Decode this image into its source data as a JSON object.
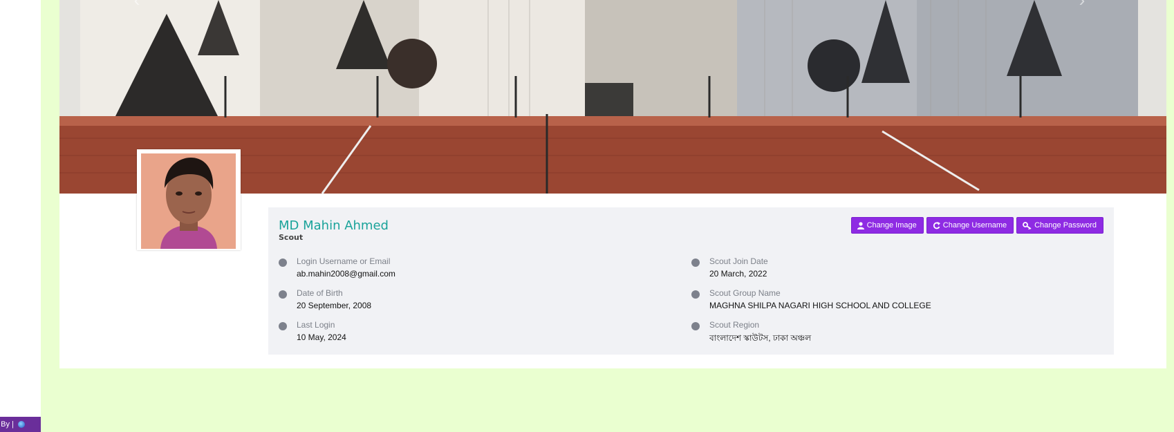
{
  "footer": {
    "powered_by": "d By |"
  },
  "profile": {
    "name": "MD Mahin Ahmed",
    "role": "Scout"
  },
  "actions": {
    "change_image": "Change Image",
    "change_username": "Change Username",
    "change_password": "Change Password"
  },
  "fields": {
    "login": {
      "label": "Login Username or Email",
      "value": "ab.mahin2008@gmail.com"
    },
    "dob": {
      "label": " Date of Birth",
      "value": "20 September, 2008"
    },
    "last_login": {
      "label": "Last Login",
      "value": "10 May, 2024"
    },
    "join_date": {
      "label": "Scout Join Date",
      "value": "20 March, 2022"
    },
    "group_name": {
      "label": "Scout Group Name",
      "value": "MAGHNA SHILPA NAGARI HIGH SCHOOL AND COLLEGE"
    },
    "region": {
      "label": "Scout Region",
      "value": "বাংলাদেশ স্কাউটস, ঢাকা অঞ্চল"
    }
  },
  "colors": {
    "accent": "#8e2be3",
    "name": "#1aa39a",
    "page_bg": "#eaffd0"
  },
  "icons": {
    "carousel_prev": "chevron-left-icon",
    "carousel_next": "chevron-right-icon"
  }
}
